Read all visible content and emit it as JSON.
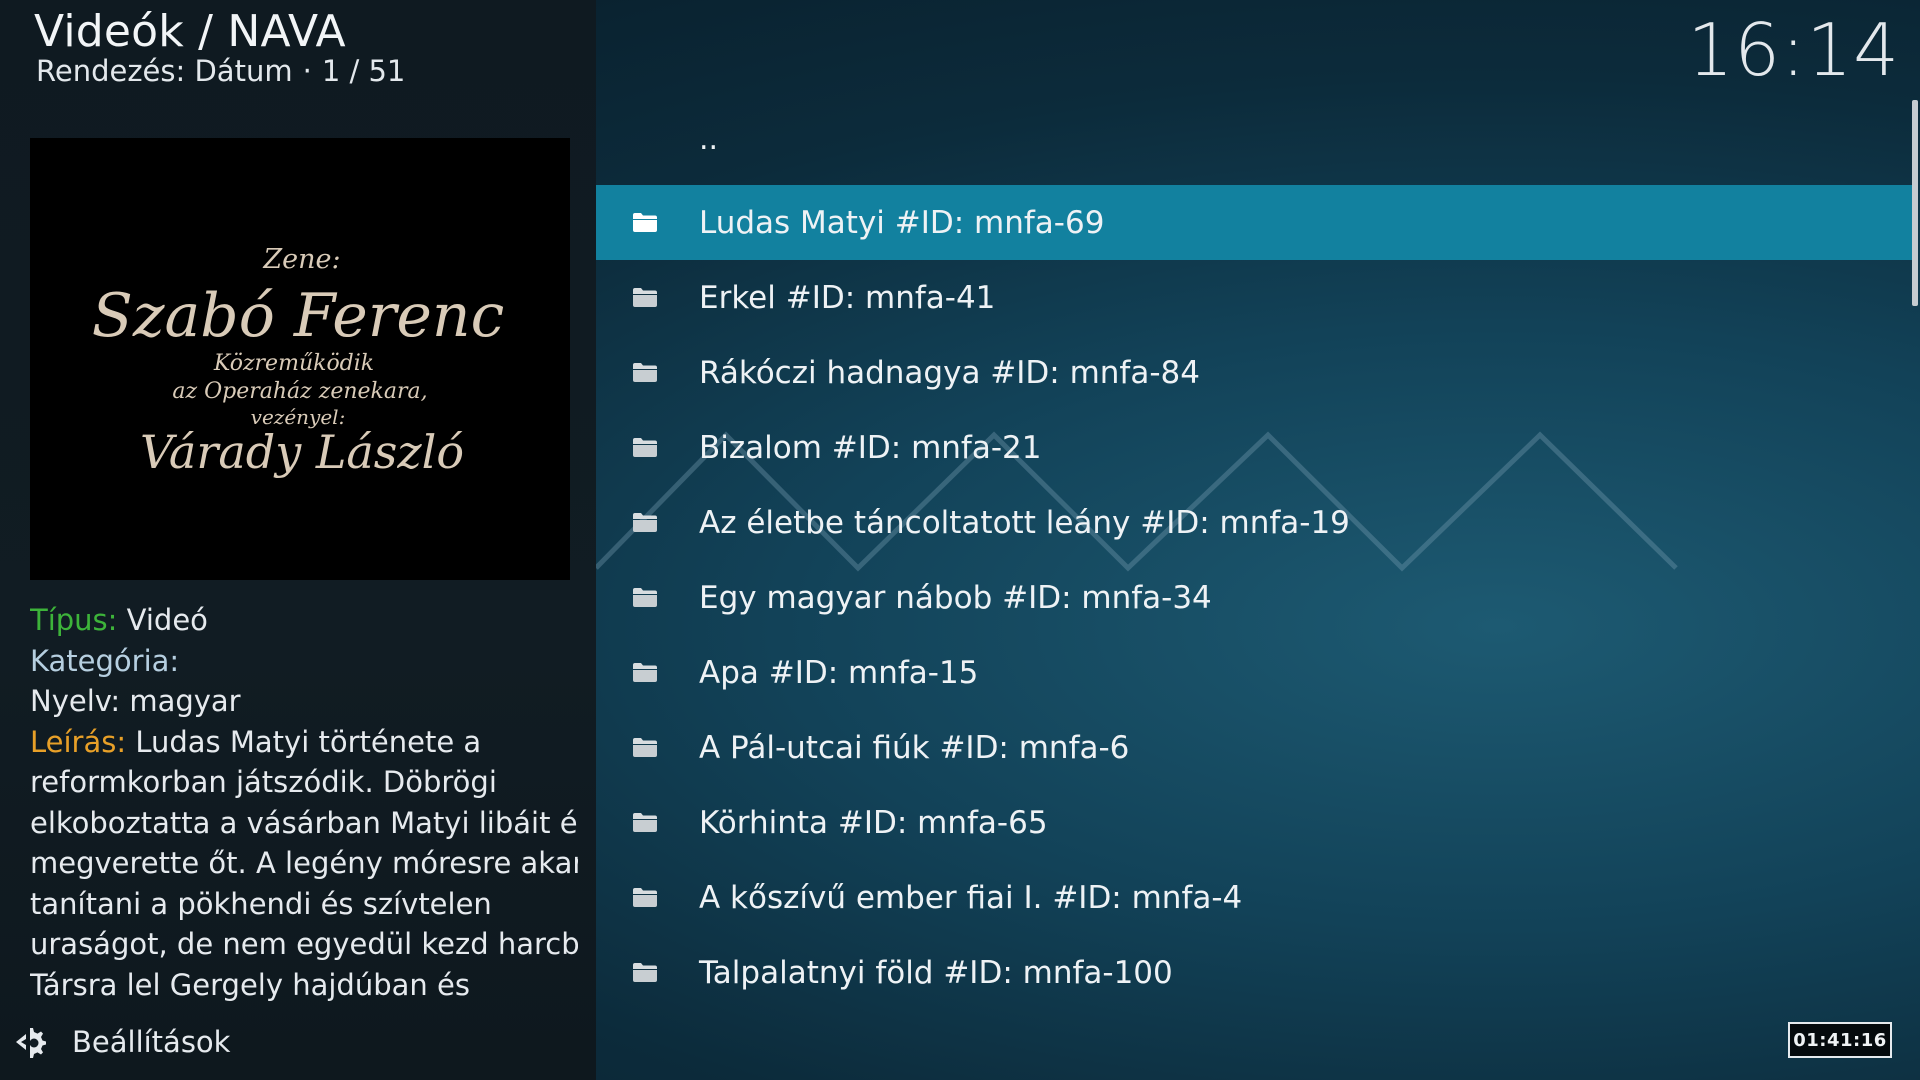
{
  "header": {
    "title": "Videók / NAVA",
    "sort_label": "Rendezés: Dátum",
    "separator": "·",
    "position": "1 / 51"
  },
  "clock": "16:14",
  "thumbnail": {
    "credit_lines": [
      "Zene:",
      "Szabó Ferenc",
      "Közreműködik",
      "az Operaház zenekara,",
      "vezényel:",
      "Várady László"
    ]
  },
  "info": {
    "type_key": "Típus:",
    "type_value": "Videó",
    "category_key": "Kategória:",
    "category_value": "",
    "language_line": "Nyelv: magyar",
    "description_key": "Leírás:",
    "description_lines": [
      "Ludas Matyi története a",
      "reformkorban játszódik. Döbrögi",
      "elkoboztatta a vásárban Matyi libáit és",
      "megverette őt. A legény móresre akarja",
      "tanítani a pökhendi és szívtelen",
      "uraságot, de nem egyedül kezd harcba.",
      "Társra lel Gergely hajdúban és"
    ]
  },
  "settings": {
    "label": "Beállítások",
    "icon": "gear-icon"
  },
  "list": {
    "parent_label": "..",
    "items": [
      {
        "label": "Ludas Matyi #ID: mnfa-69",
        "selected": true
      },
      {
        "label": "Erkel #ID: mnfa-41",
        "selected": false
      },
      {
        "label": "Rákóczi hadnagya #ID: mnfa-84",
        "selected": false
      },
      {
        "label": "Bizalom #ID: mnfa-21",
        "selected": false
      },
      {
        "label": "Az életbe táncoltatott leány #ID: mnfa-19",
        "selected": false
      },
      {
        "label": "Egy magyar nábob #ID: mnfa-34",
        "selected": false
      },
      {
        "label": "Apa #ID: mnfa-15",
        "selected": false
      },
      {
        "label": "A Pál-utcai fiúk #ID: mnfa-6",
        "selected": false
      },
      {
        "label": "Körhinta #ID: mnfa-65",
        "selected": false
      },
      {
        "label": "A kőszívű ember fiai I. #ID: mnfa-4",
        "selected": false
      },
      {
        "label": "Talpalatnyi föld #ID: mnfa-100",
        "selected": false
      }
    ],
    "item_icon": "folder-icon"
  },
  "timer": "01:41:16",
  "colors": {
    "selection": "#12819f",
    "type_key": "#3db33a",
    "category_key": "#b6cfe0",
    "description_key": "#e8a028"
  }
}
